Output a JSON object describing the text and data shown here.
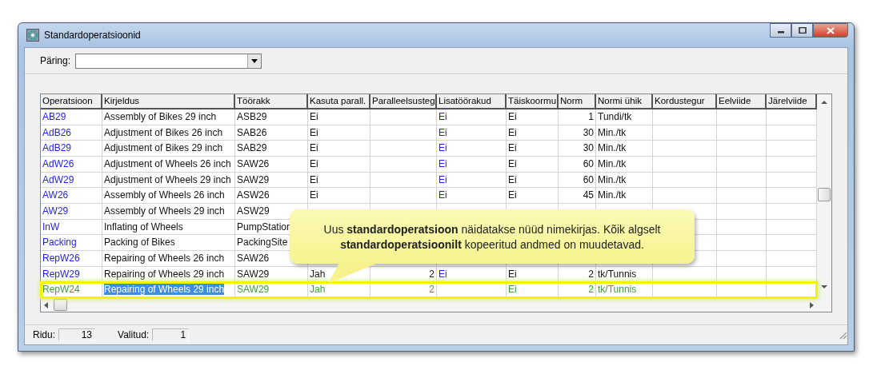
{
  "window": {
    "title": "Standardoperatsioonid"
  },
  "query": {
    "label": "Päring:"
  },
  "table": {
    "columns": [
      {
        "label": "Operatsioon",
        "kind": "link",
        "editing": false
      },
      {
        "label": "Kirjeldus",
        "kind": "text",
        "editing": true
      },
      {
        "label": "Töörakk",
        "kind": "text",
        "editing": false
      },
      {
        "label": "Kasuta parall.",
        "kind": "text",
        "editing": false
      },
      {
        "label": "Paralleelsusteg",
        "kind": "number",
        "editing": false
      },
      {
        "label": "Lisatöörakud",
        "kind": "link",
        "editing": false
      },
      {
        "label": "Täiskoormu",
        "kind": "text",
        "editing": false
      },
      {
        "label": "Norm",
        "kind": "number",
        "editing": false
      },
      {
        "label": "Normi ühik",
        "kind": "text",
        "editing": false
      },
      {
        "label": "Kordustegur",
        "kind": "text",
        "editing": false
      },
      {
        "label": "Eelviide",
        "kind": "text",
        "editing": false
      },
      {
        "label": "Järelviide",
        "kind": "text",
        "editing": false
      }
    ],
    "rows": [
      {
        "selected": false,
        "new": false,
        "cells": [
          "AB29",
          "Assembly of Bikes 29 inch",
          "ASB29",
          "Ei",
          null,
          "Ei",
          "Ei",
          "1",
          "Tundi/tk",
          null,
          null,
          null
        ]
      },
      {
        "selected": false,
        "new": false,
        "cells": [
          "AdB26",
          "Adjustment of Bikes 26 inch",
          "SAB26",
          "Ei",
          null,
          "Ei",
          "Ei",
          "30",
          "Min./tk",
          null,
          null,
          null
        ]
      },
      {
        "selected": false,
        "new": false,
        "cells": [
          "AdB29",
          "Adjustment of Bikes 29 inch",
          "SAB29",
          "Ei",
          null,
          "Ei",
          "Ei",
          "30",
          "Min./tk",
          null,
          null,
          null
        ]
      },
      {
        "selected": false,
        "new": false,
        "cells": [
          "AdW26",
          "Adjustment of Wheels 26 inch",
          "SAW26",
          "Ei",
          null,
          "Ei",
          "Ei",
          "60",
          "Min./tk",
          null,
          null,
          null
        ]
      },
      {
        "selected": false,
        "new": false,
        "cells": [
          "AdW29",
          "Adjustment of Wheels 29 inch",
          "SAW29",
          "Ei",
          null,
          "Ei",
          "Ei",
          "60",
          "Min./tk",
          null,
          null,
          null
        ]
      },
      {
        "selected": false,
        "new": false,
        "cells": [
          "AW26",
          "Assembly of Wheels 26 inch",
          "ASW26",
          "Ei",
          null,
          "Ei",
          "Ei",
          "45",
          "Min./tk",
          null,
          null,
          null
        ]
      },
      {
        "selected": false,
        "new": false,
        "cells": [
          "AW29",
          "Assembly of Wheels 29 inch",
          "ASW29",
          null,
          null,
          null,
          null,
          null,
          null,
          null,
          null,
          null
        ]
      },
      {
        "selected": false,
        "new": false,
        "cells": [
          "InW",
          "Inflating of Wheels",
          "PumpStation",
          null,
          null,
          null,
          null,
          null,
          null,
          null,
          null,
          null
        ]
      },
      {
        "selected": false,
        "new": false,
        "cells": [
          "Packing",
          "Packing of Bikes",
          "PackingSite",
          null,
          null,
          null,
          null,
          null,
          null,
          null,
          null,
          null
        ]
      },
      {
        "selected": false,
        "new": false,
        "cells": [
          "RepW26",
          "Repairing of Wheels 26 inch",
          "SAW26",
          null,
          null,
          null,
          null,
          null,
          null,
          null,
          null,
          null
        ]
      },
      {
        "selected": false,
        "new": false,
        "cells": [
          "RepW29",
          "Repairing of Wheels 29 inch",
          "SAW29",
          "Jah",
          "2",
          "Ei",
          "Ei",
          "2",
          "tk/Tunnis",
          null,
          null,
          null
        ]
      },
      {
        "selected": true,
        "new": true,
        "cells": [
          "RepW24",
          "Repairing of Wheels 29 inch",
          "SAW29",
          "Jah",
          "2",
          null,
          "Ei",
          "2",
          "tk/Tunnis",
          null,
          null,
          null
        ]
      }
    ]
  },
  "callout": {
    "lines": [
      "Uus **standardoperatsioon** näidatakse nüüd nimekirjas. Kõik algselt",
      "**standardoperatsioonilt** kopeeritud andmed on muudetavad."
    ]
  },
  "status_bar": {
    "rows_label": "Ridu:",
    "rows_value": "13",
    "selected_label": "Valitud:",
    "selected_value": "1"
  }
}
